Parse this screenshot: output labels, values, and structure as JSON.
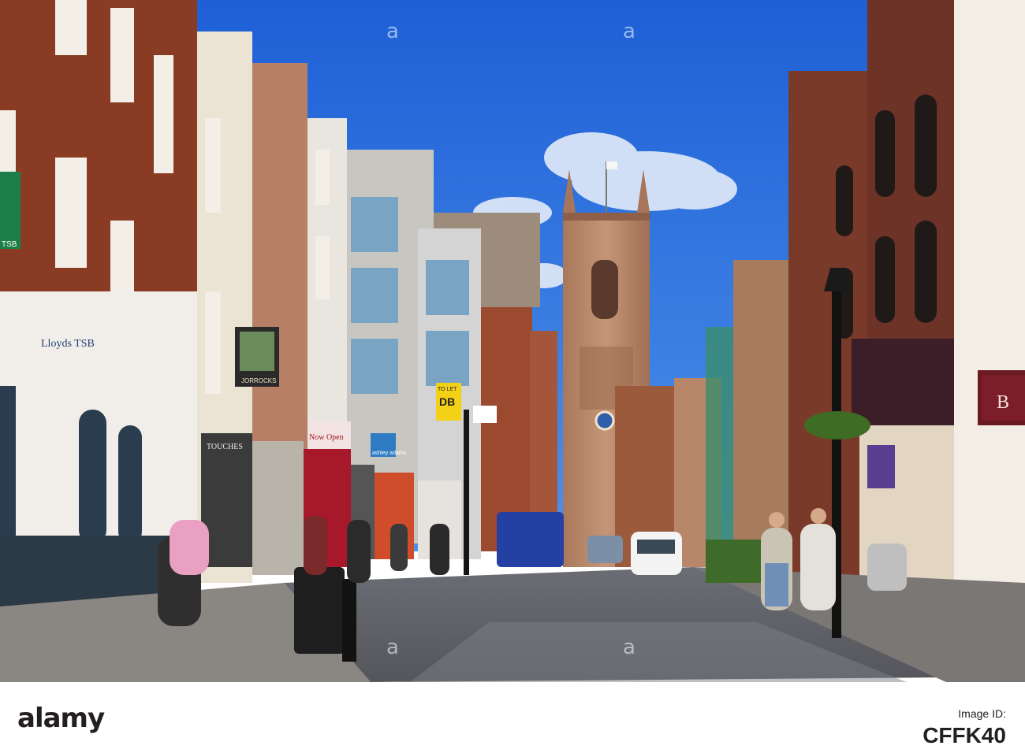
{
  "footer": {
    "brand": "alamy",
    "image_id_label": "Image ID:",
    "image_id": "CFFK40"
  },
  "signs": {
    "bank_top": "Lloyds TSB",
    "bank_small": "TSB",
    "pub": "JORROCKS",
    "shop_left": "TOUCHES",
    "shop_open": "Now Open",
    "to_let": "TO LET",
    "agent": "DB",
    "ashley": "ashley adams",
    "shop_right": "B"
  },
  "watermark": "a",
  "colors": {
    "sky_top": "#1f62d6",
    "sky_bottom": "#4a8fe8",
    "brick": "#8a3b24",
    "stone": "#b5876a",
    "road": "#6e6f76",
    "pavement": "#8a8783"
  }
}
